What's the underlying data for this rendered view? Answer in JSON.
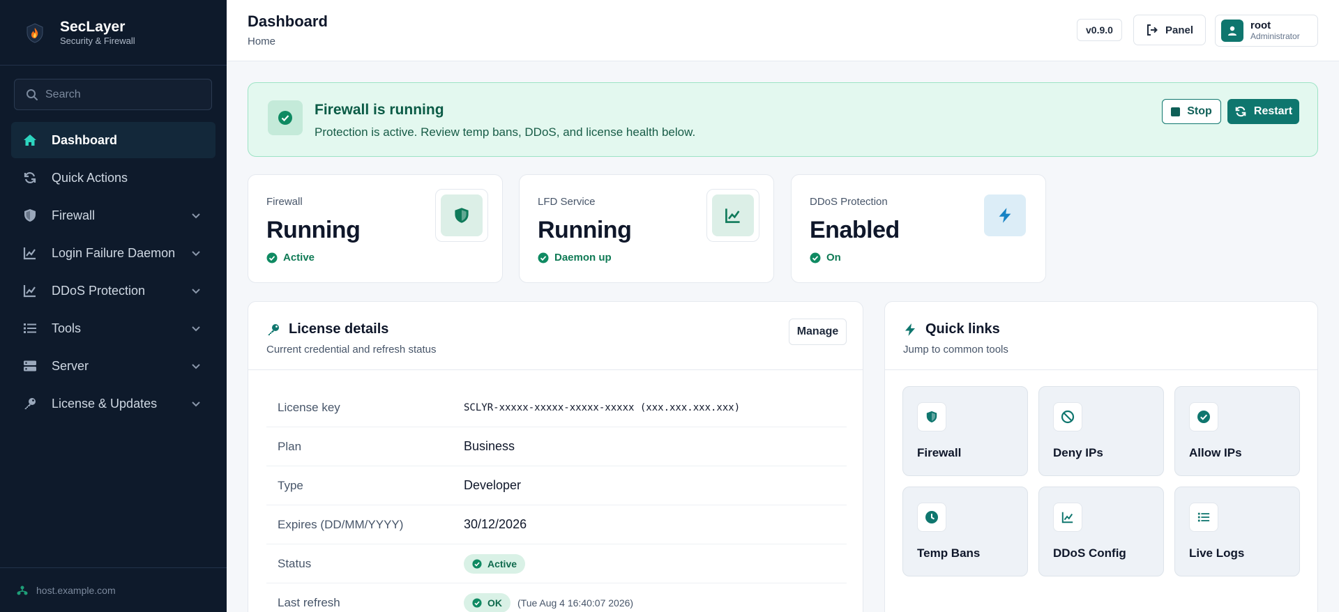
{
  "brand": {
    "title": "SecLayer",
    "subtitle": "Security & Firewall"
  },
  "search": {
    "placeholder": "Search"
  },
  "sidebar": {
    "items": [
      {
        "label": "Dashboard",
        "icon": "home-icon",
        "active": true
      },
      {
        "label": "Quick Actions",
        "icon": "refresh-icon"
      },
      {
        "label": "Firewall",
        "icon": "shield-icon"
      },
      {
        "label": "Login Failure Daemon",
        "icon": "chart-icon"
      },
      {
        "label": "DDoS Protection",
        "icon": "chart-icon"
      },
      {
        "label": "Tools",
        "icon": "list-icon"
      },
      {
        "label": "Server",
        "icon": "server-icon"
      },
      {
        "label": "License & Updates",
        "icon": "key-icon"
      }
    ],
    "host": "host.example.com"
  },
  "header": {
    "title": "Dashboard",
    "breadcrumb": "Home",
    "version": "v0.9.0",
    "panel_label": "Panel",
    "user": {
      "name": "root",
      "role": "Administrator"
    }
  },
  "alert": {
    "title": "Firewall is running",
    "description": "Protection is active. Review temp bans, DDoS, and license health below.",
    "stop_label": "Stop",
    "restart_label": "Restart"
  },
  "stats": [
    {
      "label": "Firewall",
      "value": "Running",
      "status": "Active"
    },
    {
      "label": "LFD Service",
      "value": "Running",
      "status": "Daemon up"
    },
    {
      "label": "DDoS Protection",
      "value": "Enabled",
      "status": "On"
    }
  ],
  "license": {
    "title": "License details",
    "subtitle": "Current credential and refresh status",
    "manage_label": "Manage",
    "rows": [
      {
        "key": "License key",
        "value": "SCLYR-xxxxx-xxxxx-xxxxx-xxxxx (xxx.xxx.xxx.xxx)"
      },
      {
        "key": "Plan",
        "value": "Business"
      },
      {
        "key": "Type",
        "value": "Developer"
      },
      {
        "key": "Expires (DD/MM/YYYY)",
        "value": "30/12/2026"
      },
      {
        "key": "Status",
        "value": "Active"
      },
      {
        "key": "Last refresh",
        "value": "OK",
        "note": "(Tue Aug 4 16:40:07 2026)"
      }
    ]
  },
  "quick_links": {
    "title": "Quick links",
    "subtitle": "Jump to common tools",
    "items": [
      {
        "label": "Firewall",
        "icon": "shield-icon"
      },
      {
        "label": "Deny IPs",
        "icon": "ban-icon"
      },
      {
        "label": "Allow IPs",
        "icon": "check-circle-icon"
      },
      {
        "label": "Temp Bans",
        "icon": "clock-icon"
      },
      {
        "label": "DDoS Config",
        "icon": "chart-icon"
      },
      {
        "label": "Live Logs",
        "icon": "list-icon"
      }
    ]
  },
  "colors": {
    "sidebar_bg": "#0e1a2b",
    "accent": "#0f766e",
    "success": "#0f7a55",
    "alert_bg": "#e3f8ef"
  }
}
